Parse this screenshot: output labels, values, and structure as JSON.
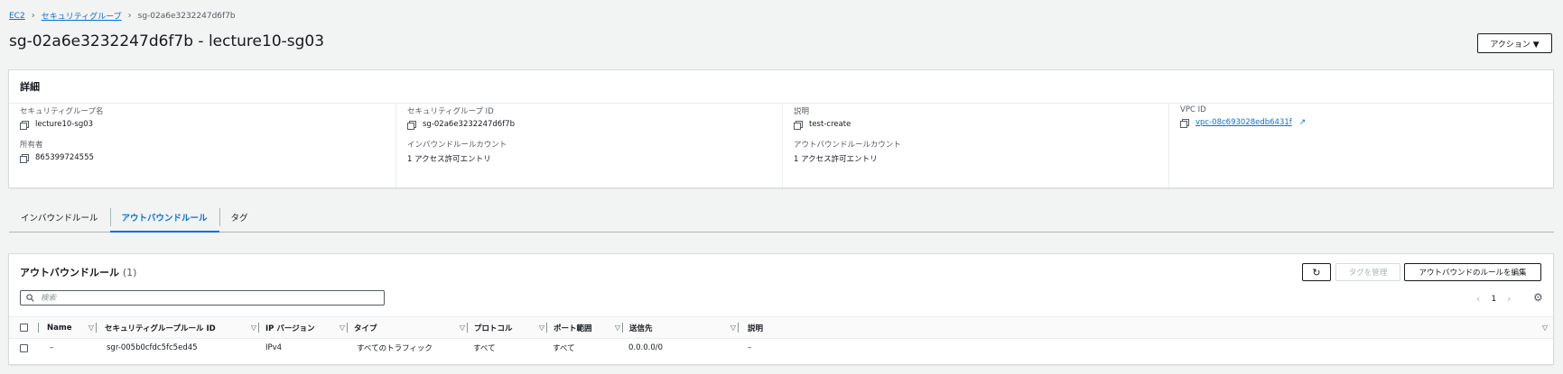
{
  "breadcrumb": {
    "root": "EC2",
    "section": "セキュリティグループ",
    "current": "sg-02a6e3232247d6f7b"
  },
  "page": {
    "title": "sg-02a6e3232247d6f7b - lecture10-sg03",
    "action_label": "アクション ▼"
  },
  "details": {
    "header": "詳細",
    "sg_name_label": "セキュリティグループ名",
    "sg_name": "lecture10-sg03",
    "sg_id_label": "セキュリティグループ ID",
    "sg_id": "sg-02a6e3232247d6f7b",
    "desc_label": "説明",
    "desc": "test-create",
    "vpc_label": "VPC ID",
    "vpc": "vpc-08c693028edb6431f",
    "owner_label": "所有者",
    "owner": "865399724555",
    "inbound_count_label": "インバウンドルールカウント",
    "inbound_count": "1 アクセス許可エントリ",
    "outbound_count_label": "アウトバウンドルールカウント",
    "outbound_count": "1 アクセス許可エントリ"
  },
  "tabs": [
    "インバウンドルール",
    "アウトバウンドルール",
    "タグ"
  ],
  "rules": {
    "title": "アウトバウンドルール",
    "count": "(1)",
    "manage_tags": "タグを管理",
    "edit_rules": "アウトバウンドのルールを編集",
    "search_placeholder": "検索",
    "page_number": "1",
    "columns": [
      "Name",
      "セキュリティグループルール ID",
      "IP バージョン",
      "タイプ",
      "プロトコル",
      "ポート範囲",
      "送信先",
      "説明"
    ],
    "row": [
      "–",
      "sgr-005b0cfdc5fc5ed45",
      "IPv4",
      "すべてのトラフィック",
      "すべて",
      "すべて",
      "0.0.0.0/0",
      "–"
    ]
  },
  "icons": {
    "refresh": "refresh-icon",
    "search": "search-icon",
    "settings": "gear-icon",
    "external": "external-link-icon",
    "copy": "copy-icon"
  },
  "colors": {
    "link": "#0972d3",
    "text": "#16191f",
    "background": "#f2f3f3"
  }
}
